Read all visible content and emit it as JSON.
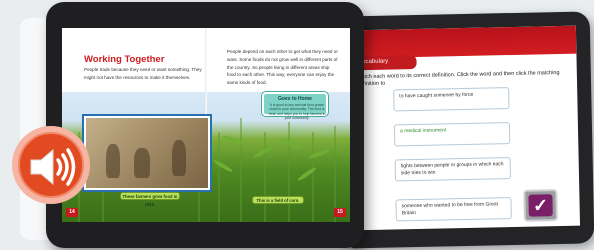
{
  "book": {
    "title": "Working Together",
    "left_paragraph": "People trade because they need or want something. They might not have the resources to make it themselves.",
    "right_paragraph": "People depend on each other to get what they need or want. Some foods do not grow well in different parts of the country. So people living in different areas ship food to each other. This way, everyone can enjoy the same kinds of food.",
    "photo_caption": "These farmers grow food in 1910.",
    "field_caption": "This is a field of corn.",
    "tip": {
      "title": "Goes to Home",
      "text": "It is good to buy and eat food grown close to your community. The food is fresh and helps you to help farmers in your community."
    },
    "page_left": "14",
    "page_right": "15"
  },
  "quiz": {
    "tab_label": "Vocabulary",
    "prompt": "Match each word to its correct definition. Click the word and then click the matching definition to",
    "options": [
      "to have caught someone by force",
      "a medical instrument",
      "fights between people or groups in which each side tries to win",
      "someone who wanted to be free from Great Britain"
    ],
    "check_symbol": "✓"
  },
  "audio": {
    "icon": "speaker-icon"
  },
  "colors": {
    "accent_red": "#d01c21",
    "audio_orange": "#e24a22",
    "caption_green": "#b9e25a",
    "tip_teal": "#7fd3c6",
    "check_purple": "#7a1e68"
  }
}
